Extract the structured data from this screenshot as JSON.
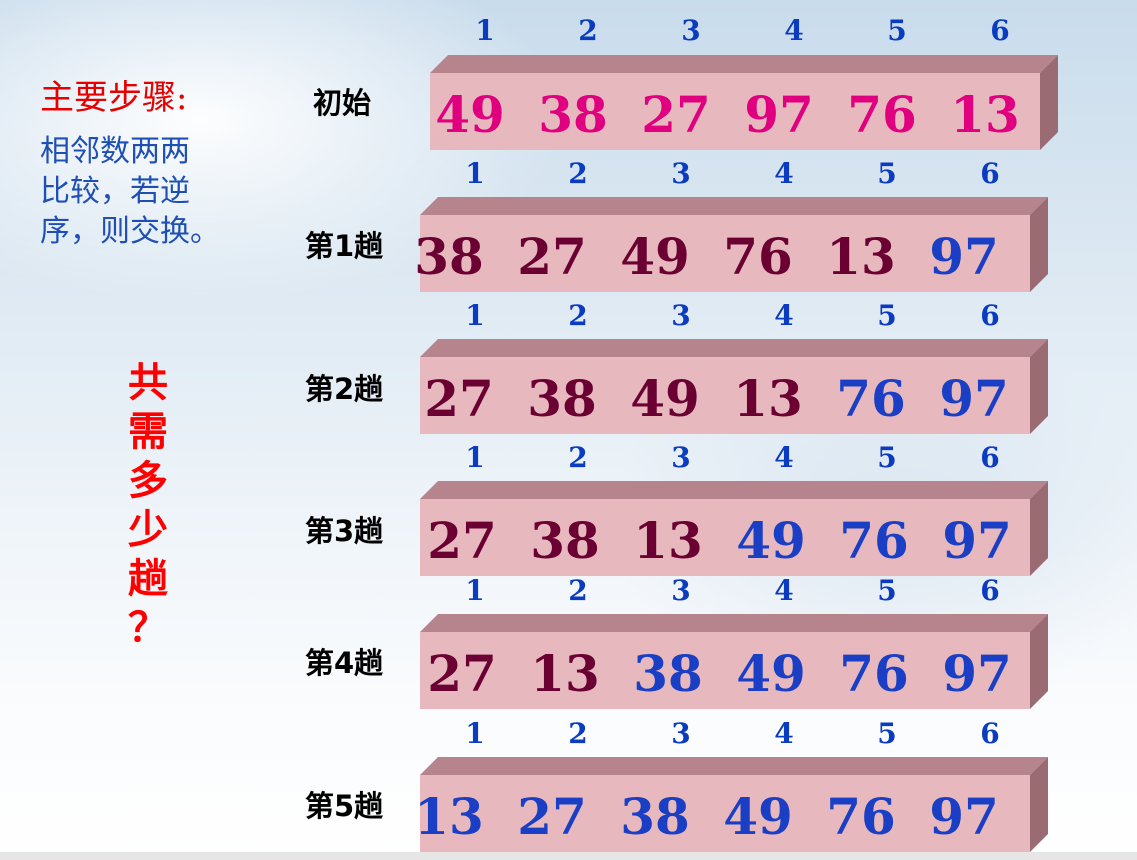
{
  "steps": {
    "title": "主要步骤:",
    "lines": [
      "相邻数两两",
      "比较，若逆",
      "序，则交换。"
    ]
  },
  "question": [
    "共",
    "需",
    "多",
    "少",
    "趟",
    "？"
  ],
  "indices": [
    "1",
    "2",
    "3",
    "4",
    "5",
    "6"
  ],
  "colors": {
    "initial": "#e0007f",
    "unsorted": "#6b0033",
    "sorted": "#1a3fc4",
    "index": "#0b3bbf",
    "bar_front": "#e7b9bf",
    "bar_top": "#b5848c",
    "bar_side": "#9a6b73"
  },
  "rows": [
    {
      "label": "初始",
      "values": [
        "49",
        "38",
        "27",
        "97",
        "76",
        "13"
      ],
      "sorted_count": 0,
      "initial": true
    },
    {
      "label": "第1趟",
      "values": [
        "38",
        "27",
        "49",
        "76",
        "13",
        "97"
      ],
      "sorted_count": 1,
      "initial": false
    },
    {
      "label": "第2趟",
      "values": [
        "27",
        "38",
        "49",
        "13",
        "76",
        "97"
      ],
      "sorted_count": 2,
      "initial": false
    },
    {
      "label": "第3趟",
      "values": [
        "27",
        "38",
        "13",
        "49",
        "76",
        "97"
      ],
      "sorted_count": 3,
      "initial": false
    },
    {
      "label": "第4趟",
      "values": [
        "27",
        "13",
        "38",
        "49",
        "76",
        "97"
      ],
      "sorted_count": 4,
      "initial": false
    },
    {
      "label": "第5趟",
      "values": [
        "13",
        "27",
        "38",
        "49",
        "76",
        "97"
      ],
      "sorted_count": 6,
      "initial": false
    }
  ]
}
